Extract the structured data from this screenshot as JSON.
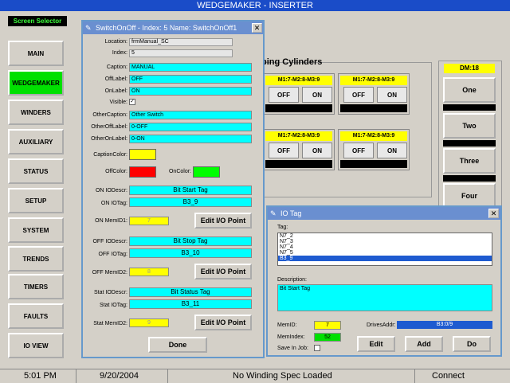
{
  "app": {
    "title": "WEDGEMAKER - INSERTER"
  },
  "sidebar": {
    "header": "Screen Selector",
    "items": [
      "MAIN",
      "WEDGEMAKER",
      "WINDERS",
      "AUXILIARY",
      "STATUS",
      "SETUP",
      "SYSTEM",
      "TRENDS",
      "TIMERS",
      "FAULTS",
      "IO VIEW"
    ],
    "active": "WEDGEMAKER"
  },
  "status": {
    "time": "5:01 PM",
    "date": "9/20/2004",
    "message": "No Winding Spec Loaded",
    "conn": "Connect"
  },
  "main": {
    "group_title": "ping Cylinders",
    "cylinders": [
      {
        "label": "M1:7-M2:8-M3:9",
        "off": "OFF",
        "on": "ON"
      },
      {
        "label": "M1:7-M2:8-M3:9",
        "off": "OFF",
        "on": "ON"
      },
      {
        "label": "M1:7-M2:8-M3:9",
        "off": "OFF",
        "on": "ON"
      },
      {
        "label": "M1:7-M2:8-M3:9",
        "off": "OFF",
        "on": "ON"
      }
    ],
    "dm": {
      "label": "DM:18",
      "buttons": [
        "One",
        "Two",
        "Three",
        "Four"
      ]
    }
  },
  "dlg1": {
    "title": "SwitchOnOff - Index: 5    Name: SwitchOnOff1",
    "labels": {
      "location": "Location:",
      "index": "Index:",
      "caption": "Caption:",
      "offlabel": "OffLabel:",
      "onlabel": "OnLabel:",
      "visible": "Visible:",
      "othercaption": "OtherCaption:",
      "otheroff": "OtherOffLabel:",
      "otheron": "OtherOnLabel:",
      "captioncolor": "CaptionColor:",
      "offcolor": "OffColor:",
      "oncolor": "OnColor:",
      "on_desc": "ON IODescr:",
      "on_tag": "ON IOTag:",
      "on_mem": "ON MemID1:",
      "off_desc": "OFF IODescr:",
      "off_tag": "OFF IOTag:",
      "off_mem": "OFF MemID2:",
      "stat_desc": "Stat IODescr:",
      "stat_tag": "Stat IOTag:",
      "stat_mem": "Stat MemID2:"
    },
    "values": {
      "location": "frmManual_SC",
      "index": "5",
      "caption": "MANUAL",
      "offlabel": "OFF",
      "onlabel": "ON",
      "othercaption": "Other Switch",
      "otheroff": "0-OFF",
      "otheron": "0-ON",
      "on_desc": "Bit Start Tag",
      "on_tag": "B3_9",
      "on_mem": "7",
      "off_desc": "Bit Stop Tag",
      "off_tag": "B3_10",
      "off_mem": "8",
      "stat_desc": "Bit Status Tag",
      "stat_tag": "B3_11",
      "stat_mem": "9"
    },
    "visible_checked": true,
    "edit_label": "Edit I/O Point",
    "done_label": "Done",
    "colors": {
      "caption": "#ffff00",
      "off": "#ff0000",
      "on": "#00ff00"
    }
  },
  "dlg2": {
    "title": "IO Tag",
    "tag_label": "Tag:",
    "tags": [
      "N7_2",
      "N7_3",
      "N7_4",
      "N7_5",
      "B3_9"
    ],
    "selected": "B3_9",
    "desc_label": "Description:",
    "desc": "Bit Start Tag",
    "memid_label": "MemID:",
    "memid": "7",
    "memindex_label": "MemIndex:",
    "memindex": "52",
    "drives_label": "DrivesAddr:",
    "drives": "B3:0/9",
    "savejob_label": "Save In Job:",
    "edit": "Edit",
    "add": "Add",
    "done": "Do"
  }
}
